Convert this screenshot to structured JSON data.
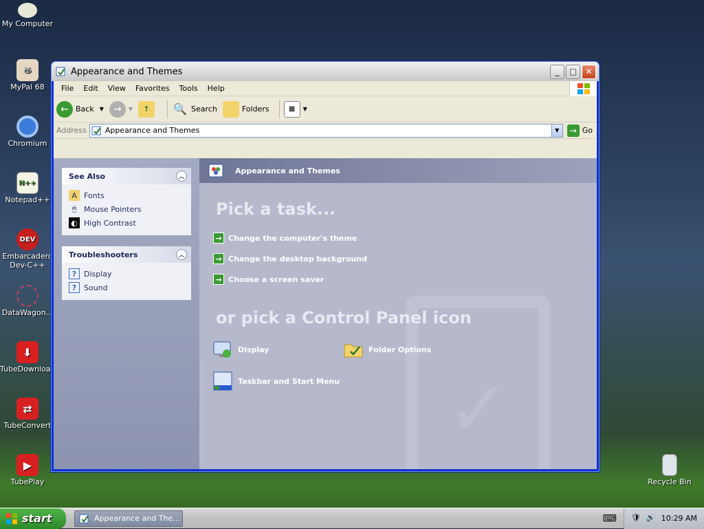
{
  "desktop": {
    "icons": [
      {
        "label": "My Computer",
        "icon": "computer-icon",
        "color": "#e8e8d8"
      },
      {
        "label": "MyPal 68",
        "icon": "mypal-icon",
        "color": "#444444"
      },
      {
        "label": "Chromium",
        "icon": "chromium-icon",
        "color": "#3b7bd9"
      },
      {
        "label": "Notepad++",
        "icon": "notepad-icon",
        "color": "#8cb84a"
      },
      {
        "label": "Embarcadero Dev-C++",
        "icon": "devcpp-icon",
        "color": "#c81e1e"
      },
      {
        "label": "DataWagon...",
        "icon": "datawagon-icon",
        "color": "#a03050"
      },
      {
        "label": "TubeDownload...",
        "icon": "tubedownload-icon",
        "color": "#d82020"
      },
      {
        "label": "TubeConvert",
        "icon": "tubeconvert-icon",
        "color": "#d82020"
      },
      {
        "label": "TubePlay",
        "icon": "tubeplay-icon",
        "color": "#d82020"
      }
    ],
    "recycle_bin": "Recycle Bin"
  },
  "window": {
    "title": "Appearance and Themes",
    "menu": [
      "File",
      "Edit",
      "View",
      "Favorites",
      "Tools",
      "Help"
    ],
    "toolbar": {
      "back": "Back",
      "search": "Search",
      "folders": "Folders"
    },
    "address": {
      "label": "Address",
      "value": "Appearance and Themes",
      "go": "Go"
    }
  },
  "sidebar": {
    "see_also": {
      "title": "See Also",
      "items": [
        {
          "label": "Fonts",
          "icon": "fonts-folder-icon"
        },
        {
          "label": "Mouse Pointers",
          "icon": "mouse-icon"
        },
        {
          "label": "High Contrast",
          "icon": "contrast-icon"
        }
      ]
    },
    "troubleshooters": {
      "title": "Troubleshooters",
      "items": [
        {
          "label": "Display",
          "icon": "help-icon"
        },
        {
          "label": "Sound",
          "icon": "help-icon"
        }
      ]
    }
  },
  "main": {
    "header": "Appearance and Themes",
    "pick_task": "Pick a task...",
    "tasks": [
      "Change the computer's theme",
      "Change the desktop background",
      "Choose a screen saver"
    ],
    "pick_icon": "or pick a Control Panel icon",
    "icons": [
      {
        "label": "Display",
        "icon": "display-icon"
      },
      {
        "label": "Folder Options",
        "icon": "folder-options-icon"
      },
      {
        "label": "Taskbar and Start Menu",
        "icon": "taskbar-icon"
      }
    ]
  },
  "taskbar": {
    "start": "start",
    "task": "Appearance and The...",
    "clock": "10:29 AM"
  }
}
